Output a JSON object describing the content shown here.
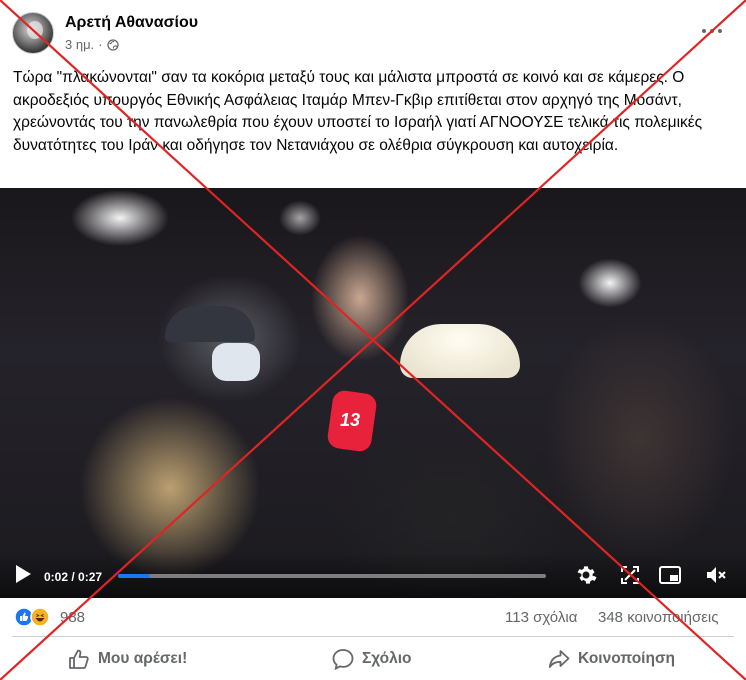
{
  "post": {
    "author": "Αρετή Αθανασίου",
    "time": "3 ημ.",
    "separator": "·",
    "privacy_icon": "globe-icon",
    "text": "Τώρα \"πλακώνονται\" σαν τα κοκόρια μεταξύ τους και μάλιστα μπροστά σε κοινό και σε κάμερες. Ο ακροδεξιός υπουργός Εθνικής Ασφάλειας Ιταμάρ Μπεν-Γκβιρ επιτίθεται στον αρχηγό της Μοσάντ, χρεώνοντάς του την πανωλεθρία που έχουν υποστεί το Ισραήλ γιατί ΑΓΝΟΟΥΣΕ τελικά τις πολεμικές δυνατότητες  του Ιράν και οδήγησε τον Νετανιάχου σε ολέθρια σύγκρουση και αυτοχειρία."
  },
  "video": {
    "current_time": "0:02",
    "duration": "0:27",
    "time_label": "0:02 / 0:27",
    "progress": 0.074,
    "mic_label": "13"
  },
  "reactions": {
    "count": "988",
    "types": [
      "like-icon",
      "haha-icon"
    ]
  },
  "stats": {
    "comments": "113 σχόλια",
    "shares": "348 κοινοποιήσεις"
  },
  "actions": {
    "like": "Μου αρέσει!",
    "comment": "Σχόλιο",
    "share": "Κοινοποίηση"
  },
  "colors": {
    "accent": "#1877f2",
    "cross": "#e02424",
    "muted": "#65676b"
  }
}
